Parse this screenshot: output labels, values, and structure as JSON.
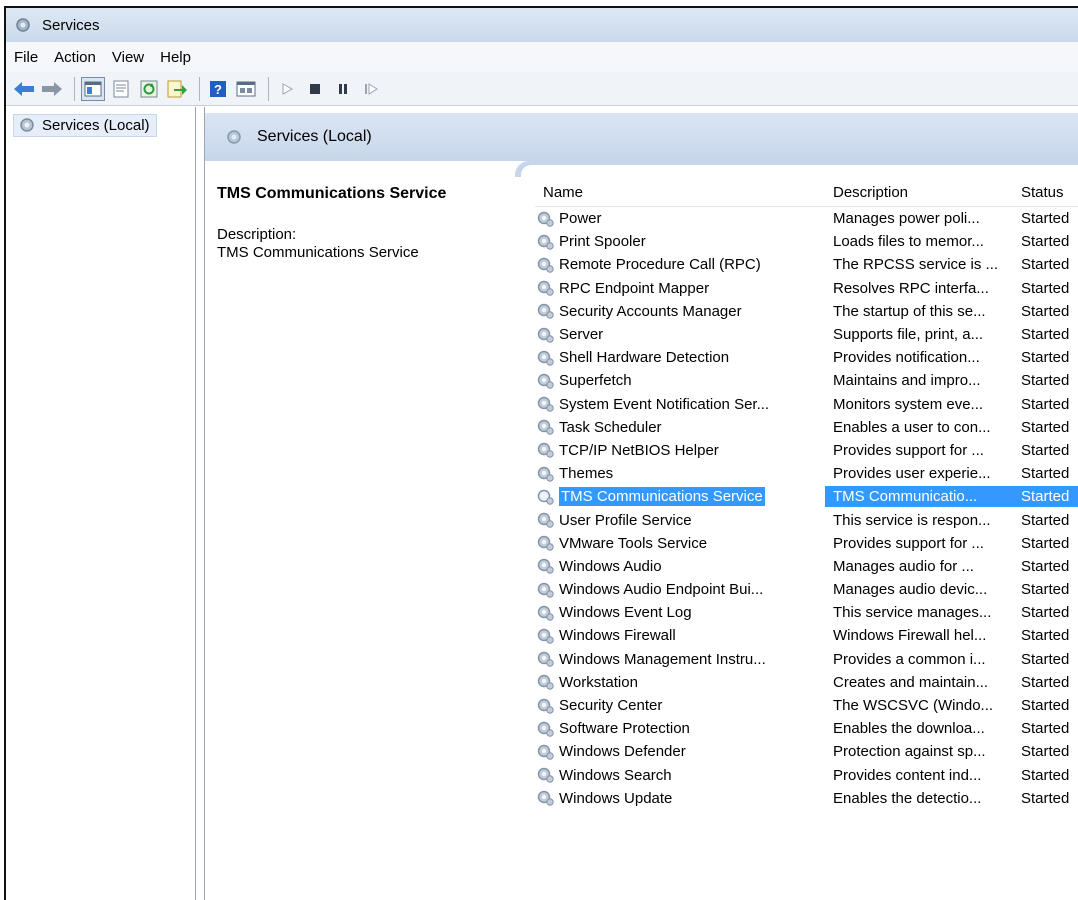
{
  "window": {
    "title": "Services"
  },
  "menu": [
    "File",
    "Action",
    "View",
    "Help"
  ],
  "toolbar": [
    "back-icon",
    "forward-icon",
    "up-icon",
    "show-hide-tree-icon",
    "properties-icon",
    "refresh-icon",
    "export-list-icon",
    "help-icon",
    "console-icon",
    "start-icon",
    "stop-icon",
    "pause-icon",
    "restart-icon"
  ],
  "tree": {
    "root_label": "Services (Local)"
  },
  "content": {
    "header_title": "Services (Local)",
    "detail": {
      "title": "TMS Communications Service",
      "description_label": "Description:",
      "description_text": "TMS Communications Service"
    }
  },
  "list": {
    "columns": {
      "name": "Name",
      "description": "Description",
      "status": "Status"
    },
    "rows": [
      {
        "name": "Power",
        "description": "Manages power poli...",
        "status": "Started"
      },
      {
        "name": "Print Spooler",
        "description": "Loads files to memor...",
        "status": "Started"
      },
      {
        "name": "Remote Procedure Call (RPC)",
        "description": "The RPCSS service is ...",
        "status": "Started"
      },
      {
        "name": "RPC Endpoint Mapper",
        "description": "Resolves RPC interfa...",
        "status": "Started"
      },
      {
        "name": "Security Accounts Manager",
        "description": "The startup of this se...",
        "status": "Started"
      },
      {
        "name": "Server",
        "description": "Supports file, print, a...",
        "status": "Started"
      },
      {
        "name": "Shell Hardware Detection",
        "description": "Provides notification...",
        "status": "Started"
      },
      {
        "name": "Superfetch",
        "description": "Maintains and impro...",
        "status": "Started"
      },
      {
        "name": "System Event Notification Ser...",
        "description": "Monitors system eve...",
        "status": "Started"
      },
      {
        "name": "Task Scheduler",
        "description": "Enables a user to con...",
        "status": "Started"
      },
      {
        "name": "TCP/IP NetBIOS Helper",
        "description": "Provides support for ...",
        "status": "Started"
      },
      {
        "name": "Themes",
        "description": "Provides user experie...",
        "status": "Started"
      },
      {
        "name": "TMS Communications Service",
        "description": "TMS Communicatio...",
        "status": "Started",
        "selected": true
      },
      {
        "name": "User Profile Service",
        "description": "This service is respon...",
        "status": "Started"
      },
      {
        "name": "VMware Tools Service",
        "description": "Provides support for ...",
        "status": "Started"
      },
      {
        "name": "Windows Audio",
        "description": "Manages audio for ...",
        "status": "Started"
      },
      {
        "name": "Windows Audio Endpoint Bui...",
        "description": "Manages audio devic...",
        "status": "Started"
      },
      {
        "name": "Windows Event Log",
        "description": "This service manages...",
        "status": "Started"
      },
      {
        "name": "Windows Firewall",
        "description": "Windows Firewall hel...",
        "status": "Started"
      },
      {
        "name": "Windows Management Instru...",
        "description": "Provides a common i...",
        "status": "Started"
      },
      {
        "name": "Workstation",
        "description": "Creates and maintain...",
        "status": "Started"
      },
      {
        "name": "Security Center",
        "description": "The WSCSVC (Windo...",
        "status": "Started"
      },
      {
        "name": "Software Protection",
        "description": "Enables the downloa...",
        "status": "Started"
      },
      {
        "name": "Windows Defender",
        "description": "Protection against sp...",
        "status": "Started"
      },
      {
        "name": "Windows Search",
        "description": "Provides content ind...",
        "status": "Started"
      },
      {
        "name": "Windows Update",
        "description": "Enables the detectio...",
        "status": "Started"
      }
    ]
  },
  "colors": {
    "selection": "#3399ff",
    "header_gradient": "#c6d6ea"
  }
}
